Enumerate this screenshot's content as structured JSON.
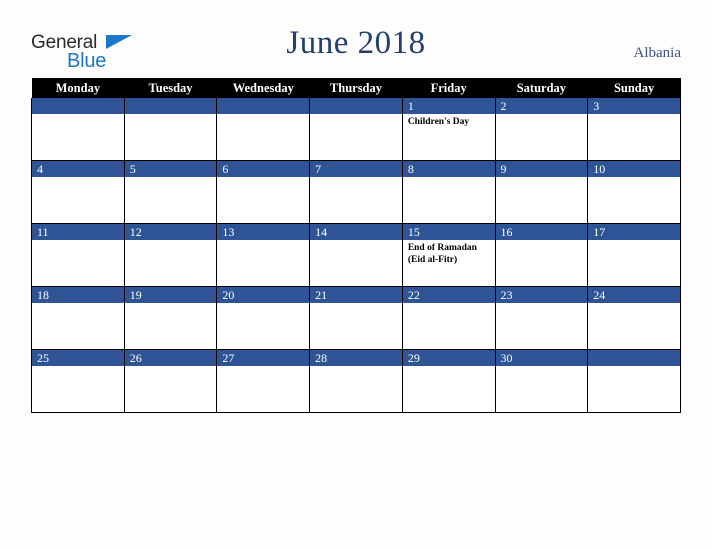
{
  "logo": {
    "word_top": "General",
    "word_bottom": "Blue",
    "triangle_icon": "triangle-icon",
    "accent_color": "#1b78c8",
    "text_color": "#2b2b2b"
  },
  "header": {
    "title": "June 2018",
    "region": "Albania",
    "title_color": "#24406e",
    "region_color": "#3b5480"
  },
  "calendar": {
    "header_background": "#000000",
    "daybar_color": "#2f5496",
    "grid_line_color": "#000000",
    "cell_background": "#ffffff",
    "weekday_headers": [
      "Monday",
      "Tuesday",
      "Wednesday",
      "Thursday",
      "Friday",
      "Saturday",
      "Sunday"
    ],
    "weeks": [
      [
        {
          "day": "",
          "events": []
        },
        {
          "day": "",
          "events": []
        },
        {
          "day": "",
          "events": []
        },
        {
          "day": "",
          "events": []
        },
        {
          "day": "1",
          "events": [
            "Children's Day"
          ]
        },
        {
          "day": "2",
          "events": []
        },
        {
          "day": "3",
          "events": []
        }
      ],
      [
        {
          "day": "4",
          "events": []
        },
        {
          "day": "5",
          "events": []
        },
        {
          "day": "6",
          "events": []
        },
        {
          "day": "7",
          "events": []
        },
        {
          "day": "8",
          "events": []
        },
        {
          "day": "9",
          "events": []
        },
        {
          "day": "10",
          "events": []
        }
      ],
      [
        {
          "day": "11",
          "events": []
        },
        {
          "day": "12",
          "events": []
        },
        {
          "day": "13",
          "events": []
        },
        {
          "day": "14",
          "events": []
        },
        {
          "day": "15",
          "events": [
            "End of Ramadan",
            "(Eid al-Fitr)"
          ]
        },
        {
          "day": "16",
          "events": []
        },
        {
          "day": "17",
          "events": []
        }
      ],
      [
        {
          "day": "18",
          "events": []
        },
        {
          "day": "19",
          "events": []
        },
        {
          "day": "20",
          "events": []
        },
        {
          "day": "21",
          "events": []
        },
        {
          "day": "22",
          "events": []
        },
        {
          "day": "23",
          "events": []
        },
        {
          "day": "24",
          "events": []
        }
      ],
      [
        {
          "day": "25",
          "events": []
        },
        {
          "day": "26",
          "events": []
        },
        {
          "day": "27",
          "events": []
        },
        {
          "day": "28",
          "events": []
        },
        {
          "day": "29",
          "events": []
        },
        {
          "day": "30",
          "events": []
        },
        {
          "day": "",
          "events": []
        }
      ]
    ]
  }
}
